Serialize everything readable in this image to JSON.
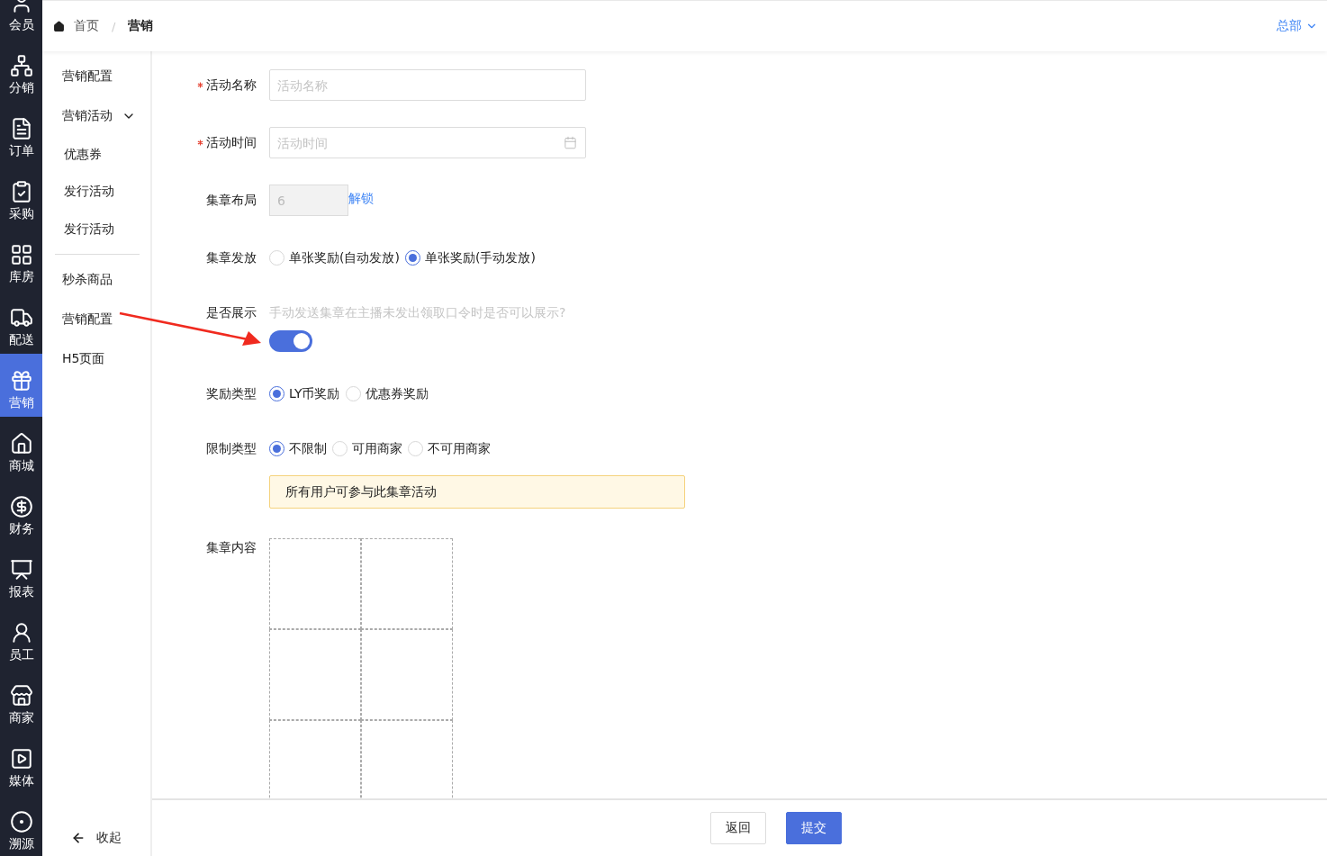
{
  "nav_rail": {
    "items": [
      {
        "label": "会员",
        "selected": false
      },
      {
        "label": "分销",
        "selected": false
      },
      {
        "label": "订单",
        "selected": false
      },
      {
        "label": "采购",
        "selected": false
      },
      {
        "label": "库房",
        "selected": false
      },
      {
        "label": "配送",
        "selected": false
      },
      {
        "label": "营销",
        "selected": true
      },
      {
        "label": "商城",
        "selected": false
      },
      {
        "label": "财务",
        "selected": false
      },
      {
        "label": "报表",
        "selected": false
      },
      {
        "label": "员工",
        "selected": false
      },
      {
        "label": "商家",
        "selected": false
      },
      {
        "label": "媒体",
        "selected": false
      },
      {
        "label": "溯源",
        "selected": false
      }
    ]
  },
  "breadcrumb": [
    "首页",
    "营销"
  ],
  "breadcrumb_separator": "/",
  "org_switch": {
    "label": "总部",
    "expanded": false
  },
  "submenu": {
    "items": [
      {
        "kind": "item",
        "label": "营销配置"
      },
      {
        "kind": "group",
        "label": "营销活动",
        "expanded": true,
        "children": [
          {
            "label": "优惠券"
          },
          {
            "label": "发行活动"
          },
          {
            "label": "发行活动"
          }
        ]
      },
      {
        "kind": "item",
        "label": "秒杀商品"
      },
      {
        "kind": "item",
        "label": "营销配置"
      },
      {
        "kind": "item",
        "label": "H5页面"
      }
    ],
    "collapse": "收起"
  },
  "form": {
    "fields": [
      {
        "kind": "text",
        "label": "活动名称",
        "required": true,
        "placeholder": "活动名称"
      },
      {
        "kind": "date",
        "label": "活动时间",
        "required": true,
        "placeholder": "活动时间"
      },
      {
        "kind": "locked",
        "label": "集章布局",
        "required": false,
        "value": "6",
        "link": "解锁"
      },
      {
        "kind": "radio",
        "label": "集章发放",
        "required": false,
        "options": [
          {
            "label": "单张奖励(自动发放)",
            "selected": false
          },
          {
            "label": "单张奖励(手动发放)",
            "selected": true
          }
        ]
      },
      {
        "kind": "switch",
        "label": "是否展示",
        "required": false,
        "hint": "手动发送集章在主播未发出领取口令时是否可以展示?",
        "on": true
      },
      {
        "kind": "radio",
        "label": "奖励类型",
        "required": false,
        "options": [
          {
            "label": "LY币奖励",
            "selected": true
          },
          {
            "label": "优惠券奖励",
            "selected": false
          }
        ]
      },
      {
        "kind": "radio",
        "label": "限制类型",
        "required": false,
        "options": [
          {
            "label": "不限制",
            "selected": true
          },
          {
            "label": "可用商家",
            "selected": false
          },
          {
            "label": "不可用商家",
            "selected": false
          }
        ],
        "notice": "所有用户可参与此集章活动"
      },
      {
        "kind": "grid",
        "label": "集章内容",
        "required": false
      }
    ]
  },
  "footer": {
    "buttons": [
      {
        "label": "返回",
        "kind": "default"
      },
      {
        "label": "提交",
        "kind": "primary"
      }
    ]
  }
}
